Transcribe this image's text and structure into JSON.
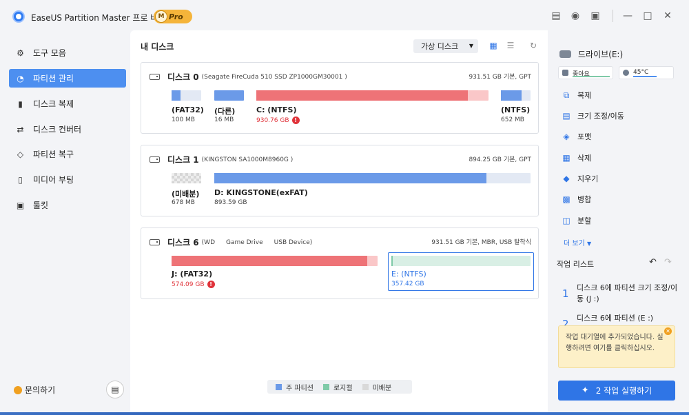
{
  "app": {
    "title": "EaseUS Partition Master 프로 버전",
    "badge_letter": "M",
    "badge": "Pro"
  },
  "titlebar_icons": [
    "notes-icon",
    "bell-icon",
    "download-icon",
    "minimize-icon",
    "maximize-icon",
    "close-icon"
  ],
  "sidebar": {
    "items": [
      {
        "label": "도구 모음",
        "icon": "toolbox-icon"
      },
      {
        "label": "파티션 관리",
        "icon": "pie-icon",
        "active": true
      },
      {
        "label": "디스크 복제",
        "icon": "clone-icon"
      },
      {
        "label": "디스크 컨버터",
        "icon": "convert-icon"
      },
      {
        "label": "파티션 복구",
        "icon": "recovery-icon"
      },
      {
        "label": "미디어 부팅",
        "icon": "usb-icon"
      },
      {
        "label": "툴킷",
        "icon": "toolkit-icon"
      }
    ],
    "help": "문의하기"
  },
  "main": {
    "title": "내 디스크",
    "virtual_disk": "가상 디스크",
    "disks": [
      {
        "name": "디스크 0",
        "model": "(Seagate FireCuda 510 SSD ZP1000GM30001 )",
        "info": "931.51 GB 기본, GPT",
        "partitions": [
          {
            "label": "(FAT32)",
            "size": "100 MB"
          },
          {
            "label": "(다른)",
            "size": "16 MB"
          },
          {
            "label": "C: (NTFS)",
            "size": "930.76 GB",
            "warn": true,
            "fill": 0.91
          },
          {
            "label": "(NTFS)",
            "size": "652 MB"
          }
        ]
      },
      {
        "name": "디스크 1",
        "model": "(KINGSTON SA1000M8960G )",
        "info": "894.25 GB 기본, GPT",
        "partitions": [
          {
            "label": "(미배분)",
            "size": "678 MB"
          },
          {
            "label": "D: KINGSTONE(exFAT)",
            "size": "893.59 GB",
            "fill": 0.86
          }
        ]
      },
      {
        "name": "디스크 6",
        "model": "(WD",
        "model2": "Game Drive",
        "model3": "USB Device)",
        "info": "931.51 GB 기본, MBR, USB 탈착식",
        "partitions": [
          {
            "label": "J: (FAT32)",
            "size": "574.09 GB",
            "warn": true,
            "fill": 0.95
          },
          {
            "label": "E: (NTFS)",
            "size": "357.42 GB",
            "fill": 0.01
          }
        ]
      }
    ],
    "legend": [
      {
        "label": "주 파티션",
        "color": "#6b9ae8"
      },
      {
        "label": "로지컬",
        "color": "#7fcaa8"
      },
      {
        "label": "미배분",
        "color": "#d9d9d9"
      }
    ]
  },
  "right": {
    "drive": "드라이브(E:)",
    "health": "좋아요",
    "temp": "45°C",
    "actions": [
      {
        "label": "복제",
        "icon": "clone-icon"
      },
      {
        "label": "크기 조정/이동",
        "icon": "resize-icon"
      },
      {
        "label": "포맷",
        "icon": "format-icon"
      },
      {
        "label": "삭제",
        "icon": "trash-icon"
      },
      {
        "label": "지우기",
        "icon": "eraser-icon"
      },
      {
        "label": "병합",
        "icon": "merge-icon"
      },
      {
        "label": "분할",
        "icon": "split-icon"
      }
    ],
    "more": "더 보기",
    "task_title": "작업 리스트",
    "tasks": [
      {
        "num": "1",
        "text": "디스크 6에 파티션 크기 조정/이동 (J :)"
      },
      {
        "num": "2",
        "text": "디스크 6에 파티션 (E :)"
      }
    ],
    "tooltip": "작업 대기열에 추가되었습니다. 실행하려면 여기를 클릭하십시오.",
    "run_button": "2 작업 실행하기"
  }
}
